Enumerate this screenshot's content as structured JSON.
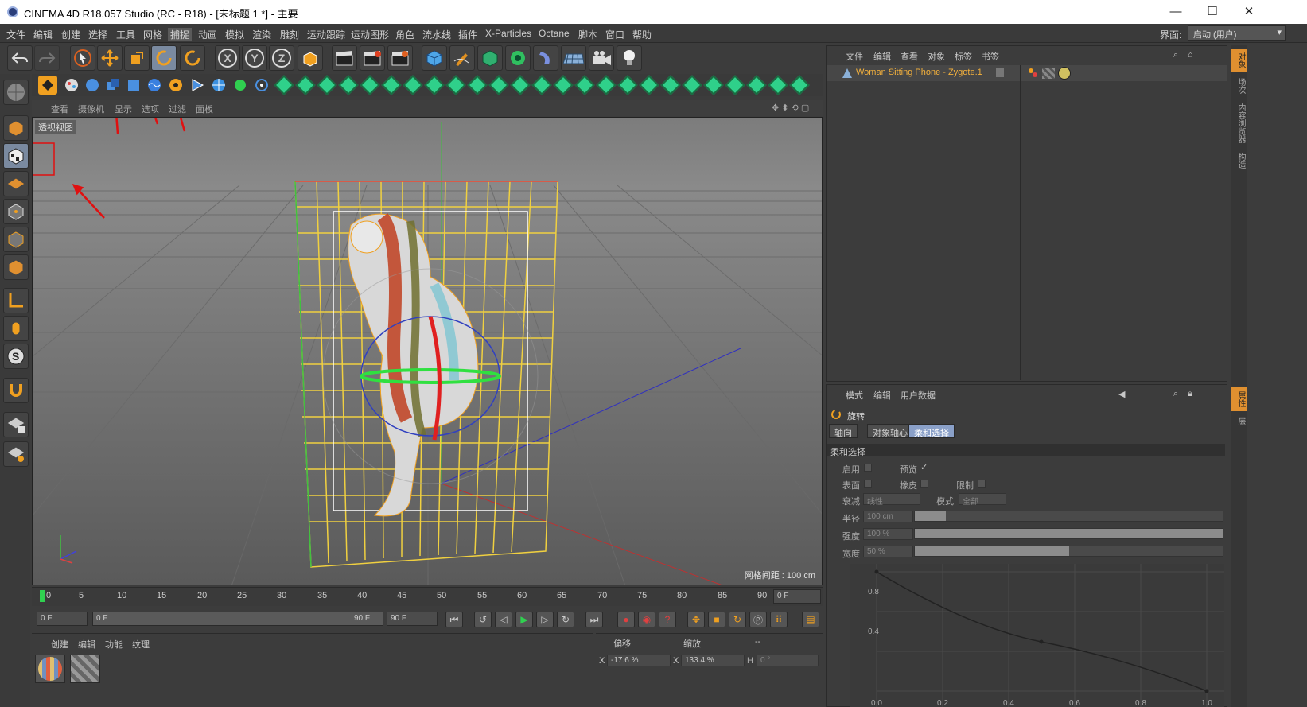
{
  "window": {
    "title": "CINEMA 4D R18.057 Studio (RC - R18) - [未标题 1 *] - 主要",
    "minimize": "—",
    "maximize": "☐",
    "close": "✕"
  },
  "menu": [
    "文件",
    "编辑",
    "创建",
    "选择",
    "工具",
    "网格",
    "捕捉",
    "动画",
    "模拟",
    "渲染",
    "雕刻",
    "运动跟踪",
    "运动图形",
    "角色",
    "流水线",
    "插件",
    "X-Particles",
    "Octane",
    "脚本",
    "窗口",
    "帮助"
  ],
  "layout": {
    "label": "界面:",
    "value": "启动 (用户)"
  },
  "toolbar": {
    "x": "X",
    "y": "Y",
    "z": "Z"
  },
  "viewport": {
    "menu": [
      "查看",
      "摄像机",
      "显示",
      "选项",
      "过滤",
      "面板"
    ],
    "label": "透视视图",
    "grid_distance": "网格间距 : 100 cm"
  },
  "object_manager": {
    "tabs": [
      "文件",
      "编辑",
      "查看",
      "对象",
      "标签",
      "书签"
    ],
    "object_name": "Woman Sitting Phone - Zygote.1"
  },
  "attribute_manager": {
    "tabs": [
      "模式",
      "编辑",
      "用户数据"
    ],
    "tool_name": "旋转",
    "subtabs": [
      "轴向",
      "对象轴心",
      "柔和选择"
    ],
    "section": "柔和选择",
    "enable_label": "启用",
    "preview_label": "预览",
    "preview_check": "✓",
    "surface_label": "表面",
    "rubber_label": "橡皮",
    "limit_label": "限制",
    "falloff_label": "衰减",
    "falloff_value": "线性",
    "mode_label": "模式",
    "mode_value": "全部",
    "radius_label": "半径",
    "radius_value": "100 cm",
    "radius_fraction": 0.1,
    "strength_label": "强度",
    "strength_value": "100 %",
    "strength_fraction": 1.0,
    "width_label": "宽度",
    "width_value": "50 %",
    "width_fraction": 0.5,
    "graph_y_labels": [
      "0.8",
      "0.4"
    ],
    "graph_x_labels": [
      "0.0",
      "0.2",
      "0.4",
      "0.6",
      "0.8",
      "1.0"
    ]
  },
  "right_strip_tabs": [
    "对象",
    "场次",
    "内容浏览器",
    "构造"
  ],
  "right_strip_tabs2": [
    "属性",
    "层"
  ],
  "timeline": {
    "ticks": [
      "0",
      "5",
      "10",
      "15",
      "20",
      "25",
      "30",
      "35",
      "40",
      "45",
      "50",
      "55",
      "60",
      "65",
      "70",
      "75",
      "80",
      "85",
      "90"
    ],
    "current_frame": "0 F",
    "start_field": "0 F",
    "range_start": "0 F",
    "range_end": "90 F",
    "end_field": "90 F"
  },
  "material_manager": {
    "tabs": [
      "创建",
      "编辑",
      "功能",
      "纹理"
    ]
  },
  "coordinates": {
    "headers": [
      "偏移",
      "缩放",
      "--"
    ],
    "x_label": "X",
    "x_offset": "-17.6 %",
    "x_scale_label": "X",
    "x_scale": "133.4 %",
    "h_label": "H",
    "h_value": "0 °"
  },
  "colors": {
    "accent_orange": "#f3b03c",
    "selected_tab": "#8aa0c8",
    "viewport_bg": "#7c7c7c"
  }
}
